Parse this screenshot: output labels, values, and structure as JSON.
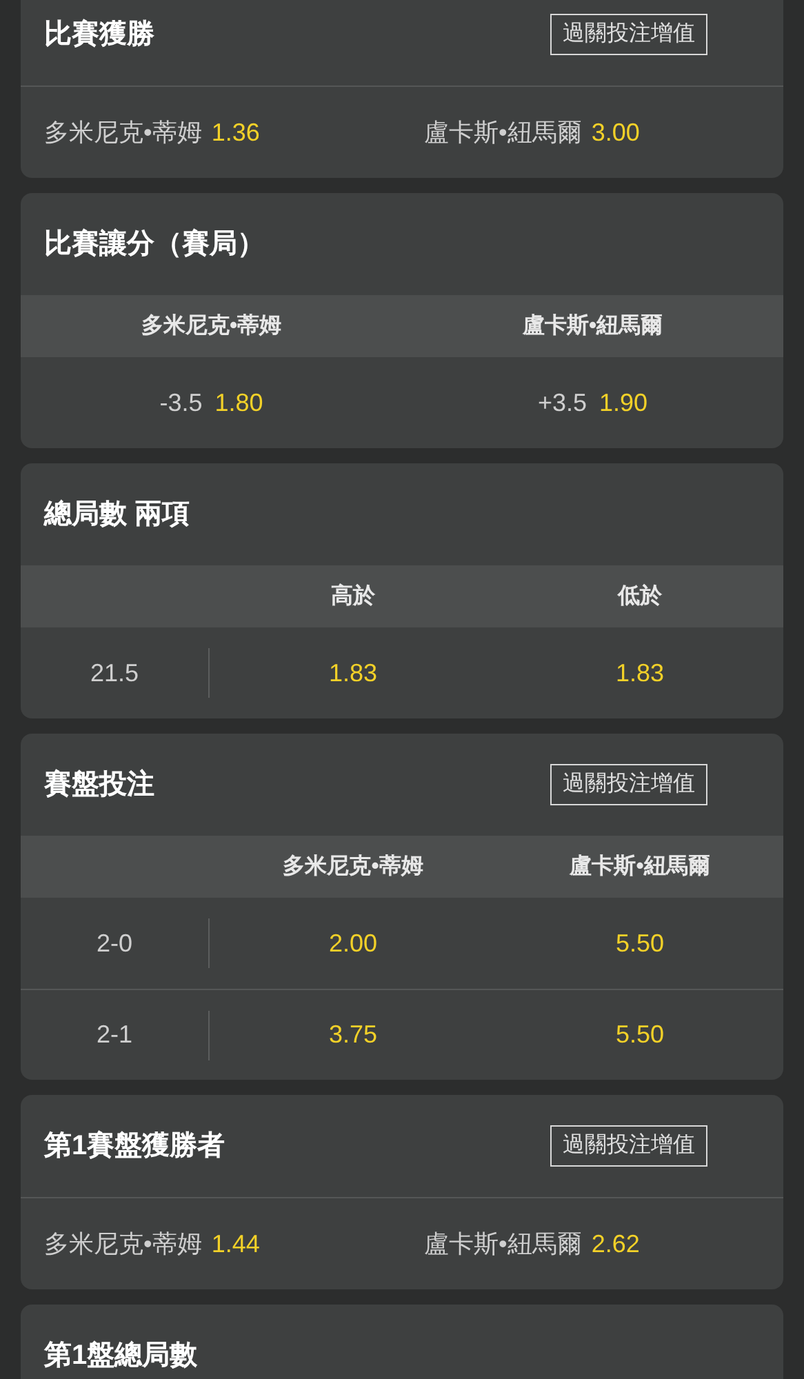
{
  "markets": [
    {
      "kind": "two_way",
      "title": "比賽獲勝",
      "parlay_boost": "過關投注增值",
      "selections": [
        {
          "name": "多米尼克•蒂姆",
          "odds": "1.36"
        },
        {
          "name": "盧卡斯•紐馬爾",
          "odds": "3.00"
        }
      ]
    },
    {
      "kind": "handicap",
      "title": "比賽讓分（賽局）",
      "columns": [
        "多米尼克•蒂姆",
        "盧卡斯•紐馬爾"
      ],
      "selections": [
        {
          "line": "-3.5",
          "odds": "1.80"
        },
        {
          "line": "+3.5",
          "odds": "1.90"
        }
      ]
    },
    {
      "kind": "table",
      "title": "總局數 兩項",
      "columns": [
        "高於",
        "低於"
      ],
      "rows": [
        {
          "label": "21.5",
          "odds": [
            "1.83",
            "1.83"
          ]
        }
      ]
    },
    {
      "kind": "table",
      "title": "賽盤投注",
      "parlay_boost": "過關投注增值",
      "columns": [
        "多米尼克•蒂姆",
        "盧卡斯•紐馬爾"
      ],
      "rows": [
        {
          "label": "2-0",
          "odds": [
            "2.00",
            "5.50"
          ]
        },
        {
          "label": "2-1",
          "odds": [
            "3.75",
            "5.50"
          ]
        }
      ]
    },
    {
      "kind": "two_way",
      "title": "第1賽盤獲勝者",
      "parlay_boost": "過關投注增值",
      "selections": [
        {
          "name": "多米尼克•蒂姆",
          "odds": "1.44"
        },
        {
          "name": "盧卡斯•紐馬爾",
          "odds": "2.62"
        }
      ]
    },
    {
      "kind": "title_only",
      "title": "第1盤總局數"
    }
  ]
}
